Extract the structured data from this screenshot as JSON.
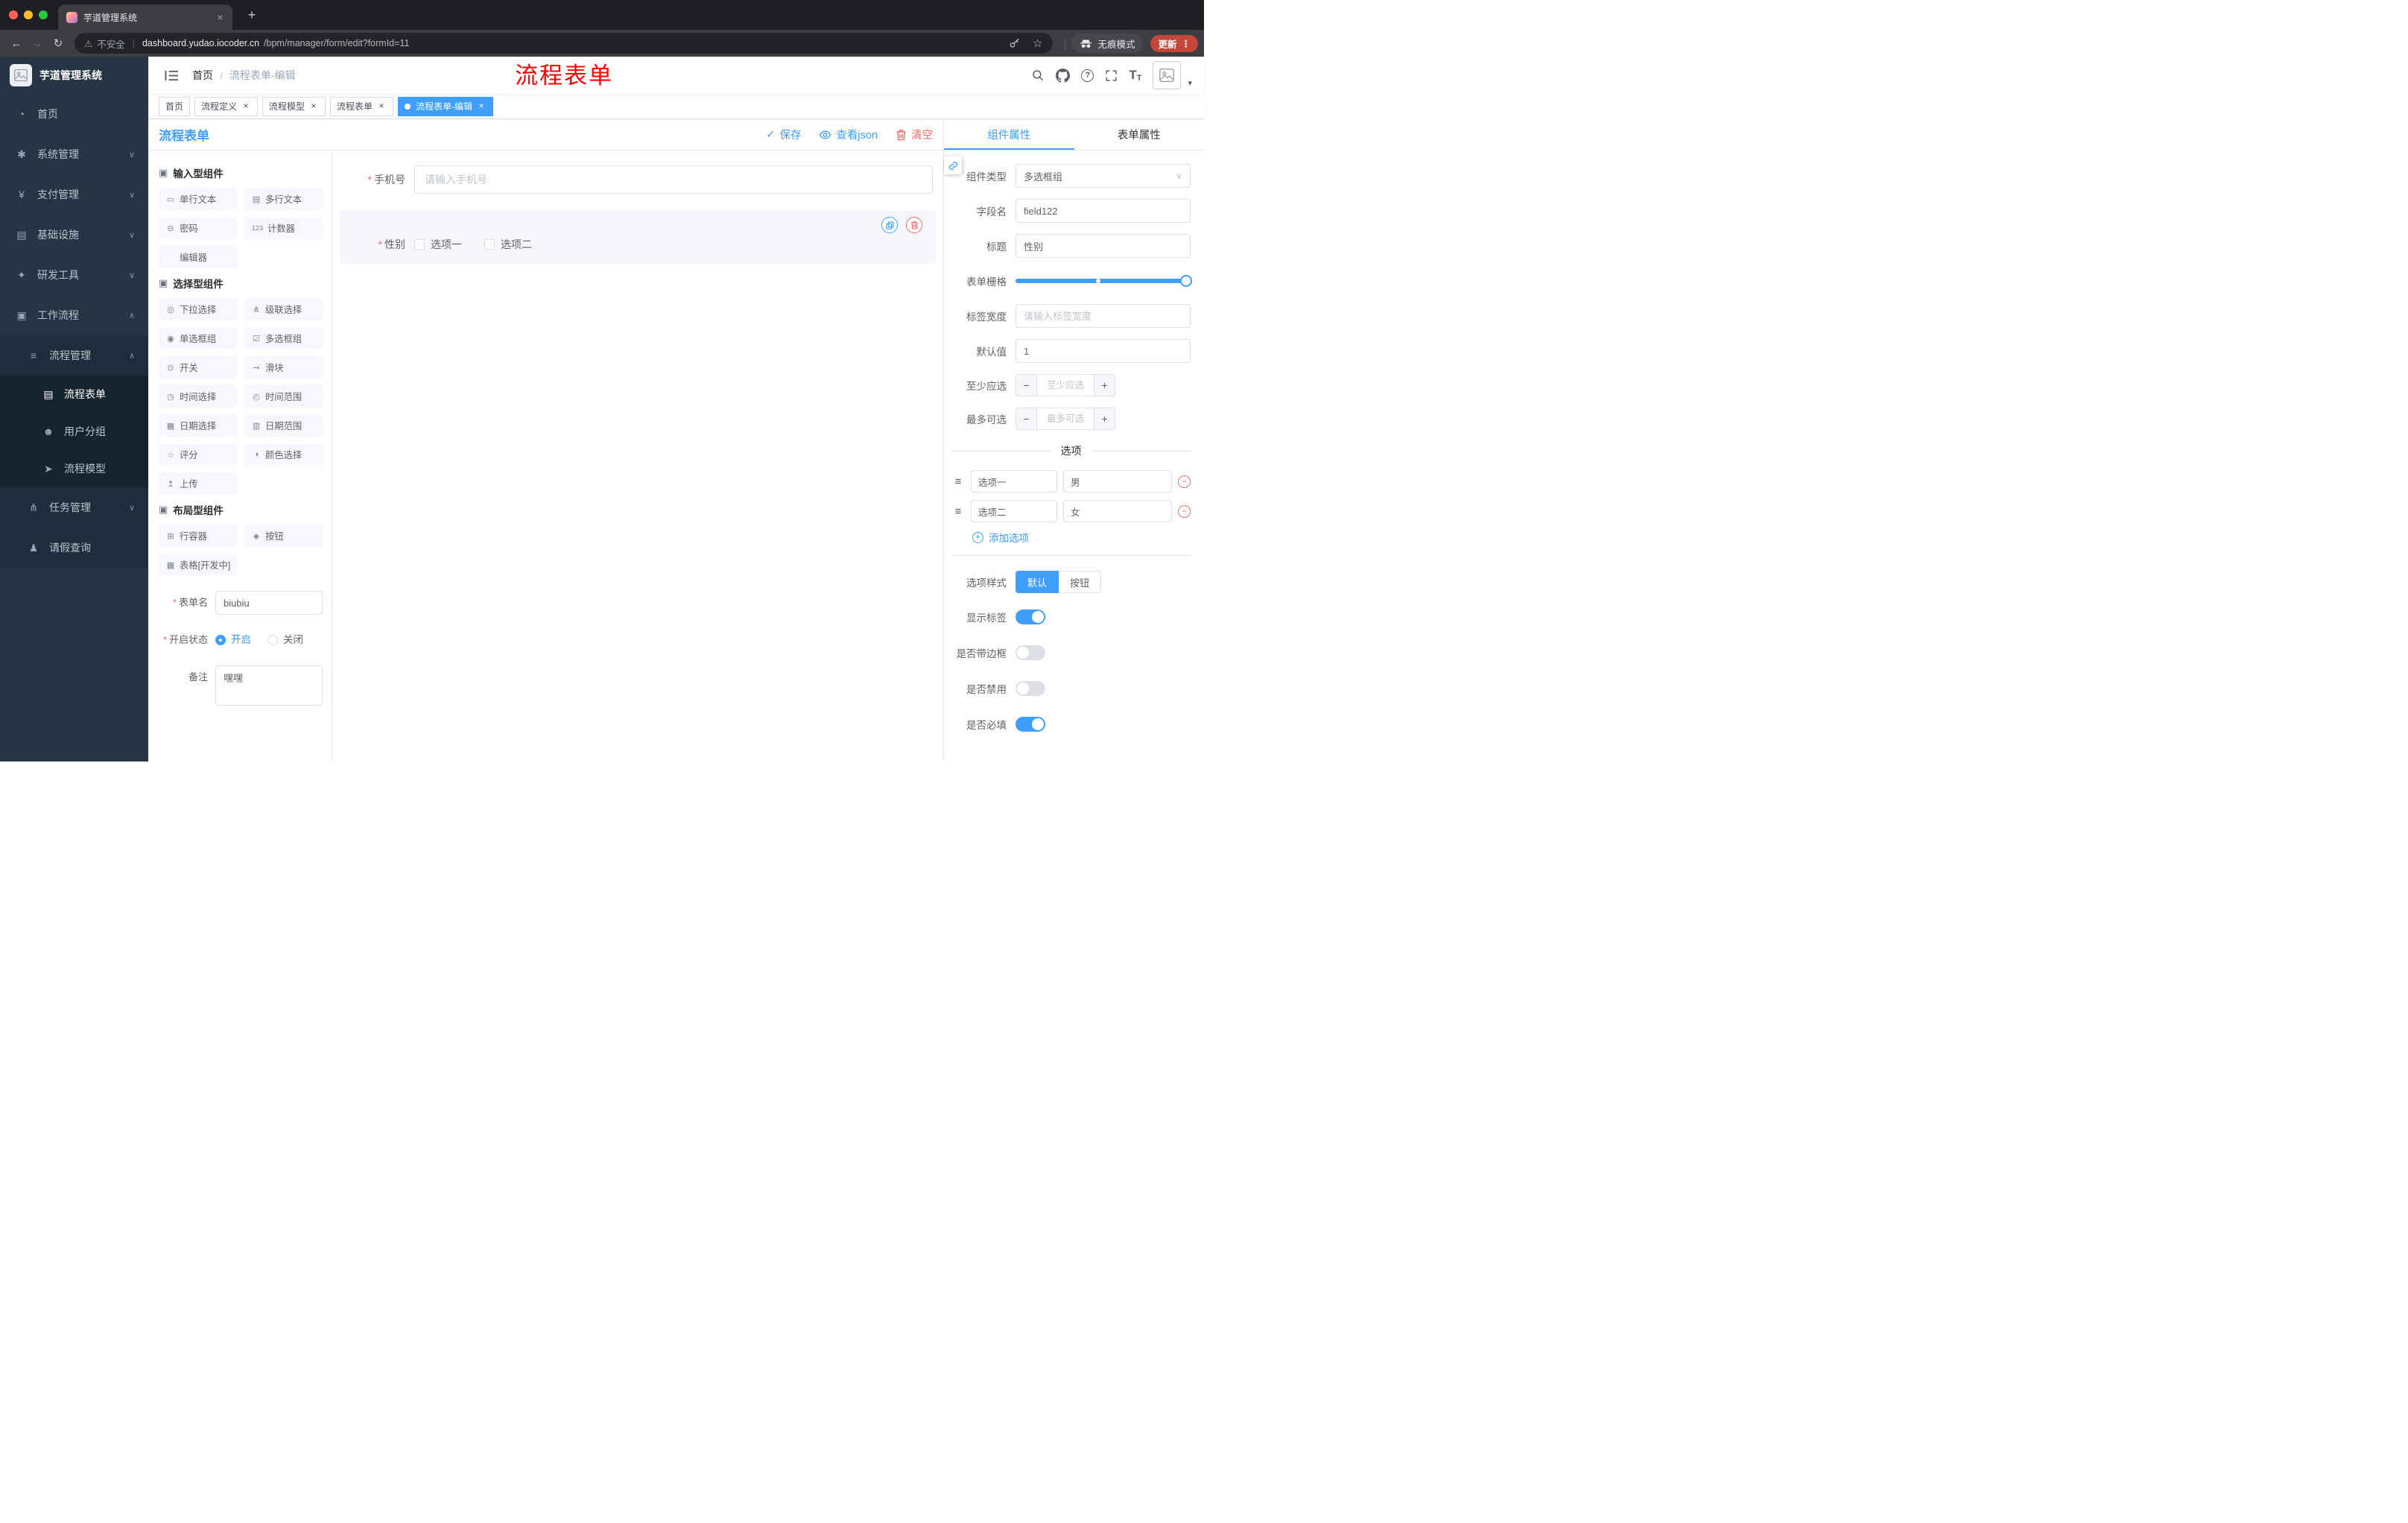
{
  "colors": {
    "accent": "#409eff",
    "danger": "#f56c6c",
    "annotation": "#ff0000"
  },
  "glyphs": {
    "close": "×",
    "plus": "+",
    "back": "←",
    "forward": "→",
    "reload": "↻",
    "warning": "⚠",
    "pipe": "|",
    "star": "☆",
    "dots": "⋮",
    "caret_down": "▾",
    "check": "✓",
    "question": "?",
    "minus": "−",
    "chevron_down": "∨",
    "text_icon": "T"
  },
  "browser": {
    "tab_title": "芋道管理系统",
    "security_label": "不安全",
    "url_host": "dashboard.yudao.iocoder.cn",
    "url_path": "/bpm/manager/form/edit?formId=11",
    "incognito_label": "无痕模式",
    "update_label": "更新"
  },
  "sidebar": {
    "brand": "芋道管理系统",
    "menu": [
      {
        "label": "首页",
        "icon": "◔"
      },
      {
        "label": "系统管理",
        "icon": "✱",
        "chevron": "∨"
      },
      {
        "label": "支付管理",
        "icon": "¥",
        "chevron": "∨"
      },
      {
        "label": "基础设施",
        "icon": "▤",
        "chevron": "∨"
      },
      {
        "label": "研发工具",
        "icon": "✦",
        "chevron": "∨"
      },
      {
        "label": "工作流程",
        "icon": "▣",
        "chevron": "∧"
      }
    ],
    "workflow": {
      "process_mgmt": {
        "label": "流程管理",
        "icon": "≡",
        "chevron": "∧"
      },
      "children": [
        {
          "label": "流程表单",
          "icon": "▤",
          "active": true
        },
        {
          "label": "用户分组",
          "icon": "☻"
        },
        {
          "label": "流程模型",
          "icon": "➤"
        }
      ],
      "task_mgmt": {
        "label": "任务管理",
        "icon": "⋔",
        "chevron": "∨"
      },
      "leave_query": {
        "label": "请假查询",
        "icon": "♟"
      }
    }
  },
  "navbar": {
    "breadcrumb": {
      "root": "首页",
      "separator": "/",
      "current": "流程表单-编辑"
    },
    "annotation": "流程表单"
  },
  "tags": [
    {
      "label": "首页",
      "closable": false,
      "active": false
    },
    {
      "label": "流程定义",
      "closable": true,
      "active": false
    },
    {
      "label": "流程模型",
      "closable": true,
      "active": false
    },
    {
      "label": "流程表单",
      "closable": true,
      "active": false
    },
    {
      "label": "流程表单-编辑",
      "closable": true,
      "active": true
    }
  ],
  "designer": {
    "title": "流程表单",
    "actions": {
      "save": "保存",
      "view_json": "查看json",
      "clear": "清空"
    },
    "palette": {
      "input_section": {
        "title": "输入型组件",
        "items": [
          {
            "label": "单行文本",
            "icon": "▭"
          },
          {
            "label": "多行文本",
            "icon": "▤"
          },
          {
            "label": "密码",
            "icon": "⊝"
          },
          {
            "label": "计数器",
            "icon": "123"
          },
          {
            "label": "编辑器",
            "icon": ""
          }
        ]
      },
      "select_section": {
        "title": "选择型组件",
        "items": [
          {
            "label": "下拉选择",
            "icon": "◎"
          },
          {
            "label": "级联选择",
            "icon": "⋔"
          },
          {
            "label": "单选框组",
            "icon": "◉"
          },
          {
            "label": "多选框组",
            "icon": "☑"
          },
          {
            "label": "开关",
            "icon": "⊙"
          },
          {
            "label": "滑块",
            "icon": "⊸"
          },
          {
            "label": "时间选择",
            "icon": "◷"
          },
          {
            "label": "时间范围",
            "icon": "◴"
          },
          {
            "label": "日期选择",
            "icon": "▦"
          },
          {
            "label": "日期范围",
            "icon": "▥"
          },
          {
            "label": "评分",
            "icon": "☆"
          },
          {
            "label": "颜色选择",
            "icon": "◑"
          },
          {
            "label": "上传",
            "icon": "↥"
          }
        ]
      },
      "layout_section": {
        "title": "布局型组件",
        "items": [
          {
            "label": "行容器",
            "icon": "⊞"
          },
          {
            "label": "按钮",
            "icon": "◈"
          },
          {
            "label": "表格[开发中]",
            "icon": "▦"
          }
        ]
      }
    },
    "meta_form": {
      "form_name": {
        "label": "表单名",
        "value": "biubiu",
        "required": true
      },
      "status": {
        "label": "开启状态",
        "required": true,
        "options": [
          "开启",
          "关闭"
        ],
        "selected": "开启"
      },
      "remark": {
        "label": "备注",
        "value": "嘿嘿"
      }
    }
  },
  "canvas": {
    "phone_field": {
      "label": "手机号",
      "required": true,
      "placeholder": "请输入手机号"
    },
    "gender_field": {
      "label": "性别",
      "required": true,
      "options": [
        "选项一",
        "选项二"
      ],
      "checked": [
        false,
        false
      ]
    }
  },
  "props": {
    "tabs": {
      "component": "组件属性",
      "form": "表单属性"
    },
    "rows": {
      "component_type": {
        "label": "组件类型",
        "value": "多选框组"
      },
      "field_name": {
        "label": "字段名",
        "value": "field122"
      },
      "title": {
        "label": "标题",
        "value": "性别"
      },
      "grid": {
        "label": "表单栅格"
      },
      "label_width": {
        "label": "标签宽度",
        "placeholder": "请输入标签宽度"
      },
      "default_value": {
        "label": "默认值",
        "value": "1"
      },
      "min_select": {
        "label": "至少应选",
        "placeholder": "至少应选"
      },
      "max_select": {
        "label": "最多可选",
        "placeholder": "最多可选"
      }
    },
    "options_section": {
      "divider_label": "选项",
      "options": [
        {
          "name": "选项一",
          "value": "男"
        },
        {
          "name": "选项二",
          "value": "女"
        }
      ],
      "add_label": "添加选项"
    },
    "style_row": {
      "label": "选项样式",
      "options": [
        "默认",
        "按钮"
      ],
      "selected": "默认"
    },
    "switches": [
      {
        "label": "显示标签",
        "on": true
      },
      {
        "label": "是否带边框",
        "on": false
      },
      {
        "label": "是否禁用",
        "on": false
      },
      {
        "label": "是否必填",
        "on": true
      }
    ]
  }
}
